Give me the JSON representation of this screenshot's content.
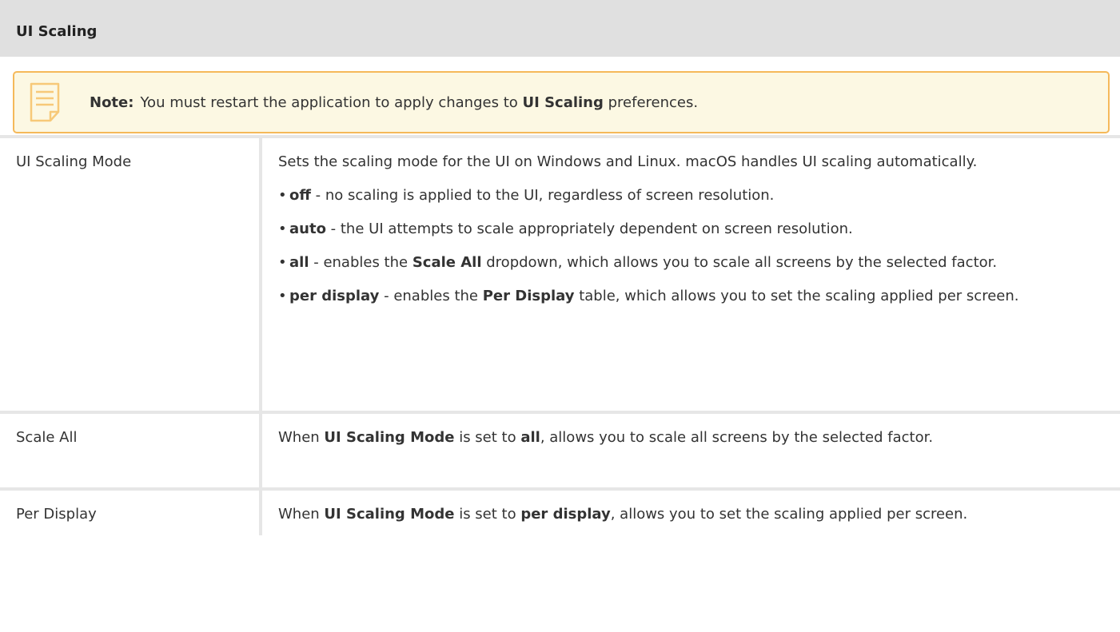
{
  "section": {
    "title": "UI Scaling"
  },
  "note": {
    "icon": "note-icon",
    "label": "Note:",
    "text_before": "You must restart the application to apply changes to ",
    "text_bold": "UI Scaling",
    "text_after": " preferences."
  },
  "rows": [
    {
      "name": "UI Scaling Mode",
      "intro": "Sets the scaling mode for the UI on Windows and Linux. macOS handles UI scaling automatically.",
      "options": [
        {
          "key": "off",
          "text": " - no scaling is applied to the UI, regardless of screen resolution."
        },
        {
          "key": "auto",
          "text": " - the UI attempts to scale appropriately dependent on screen resolution."
        },
        {
          "key": "all",
          "text_before": " - enables the ",
          "bold": "Scale All",
          "text_after": " dropdown, which allows you to scale all screens by the selected factor."
        },
        {
          "key": "per display",
          "text_before": " - enables the ",
          "bold": "Per Display",
          "text_after": " table, which allows you to set the scaling applied per screen."
        }
      ]
    },
    {
      "name": "Scale All",
      "p1": "When ",
      "b1": "UI Scaling Mode",
      "p2": " is set to ",
      "b2": "all",
      "p3": ", allows you to scale all screens by the selected factor."
    },
    {
      "name": "Per Display",
      "p1": "When ",
      "b1": "UI Scaling Mode",
      "p2": " is set to ",
      "b2": "per display",
      "p3": ", allows you to set the scaling applied per screen."
    }
  ],
  "colors": {
    "header_bg": "#e0e0e0",
    "note_border": "#f5b95a",
    "note_bg": "#fcf8e3"
  }
}
